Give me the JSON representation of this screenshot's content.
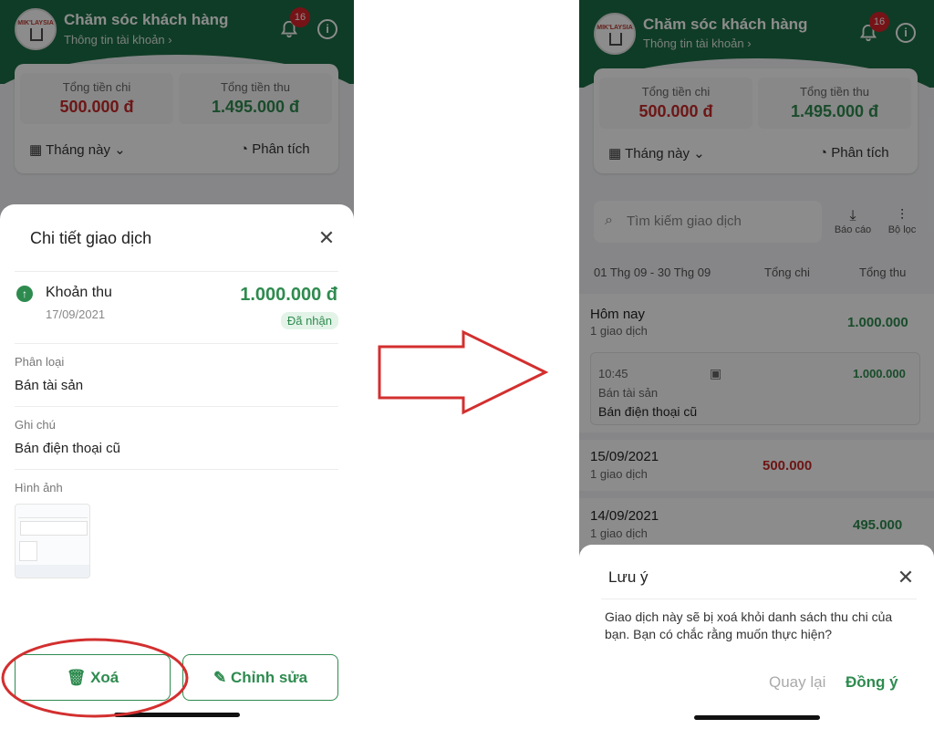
{
  "header": {
    "title": "Chăm sóc khách hàng",
    "subtitle": "Thông tin tài khoản",
    "badge_count": "16",
    "logo_text": "MIK'LAYSIA"
  },
  "summary": {
    "expense_label": "Tổng tiền chi",
    "expense_value": "500.000 đ",
    "income_label": "Tổng tiền thu",
    "income_value": "1.495.000 đ",
    "period_label": "Tháng này",
    "analyze_label": "Phân tích"
  },
  "detail_sheet": {
    "title": "Chi tiết giao dịch",
    "type_label": "Khoản thu",
    "date": "17/09/2021",
    "amount": "1.000.000 đ",
    "status": "Đã nhận",
    "category_label": "Phân loại",
    "category_value": "Bán tài sản",
    "note_label": "Ghi chú",
    "note_value": "Bán điện thoại cũ",
    "image_label": "Hình ảnh",
    "delete_label": "Xoá",
    "edit_label": "Chỉnh sửa"
  },
  "list": {
    "search_placeholder": "Tìm kiếm giao dịch",
    "report_label": "Báo cáo",
    "filter_label": "Bộ lọc",
    "date_range": "01 Thg 09 - 30 Thg 09",
    "col_expense": "Tổng chi",
    "col_income": "Tổng thu",
    "groups": [
      {
        "title": "Hôm nay",
        "count": "1 giao dịch",
        "income": "1.000.000"
      },
      {
        "title": "15/09/2021",
        "count": "1 giao dịch",
        "expense": "500.000"
      },
      {
        "title": "14/09/2021",
        "count": "1 giao dịch",
        "income": "495.000"
      }
    ],
    "item": {
      "time": "10:45",
      "category": "Bán tài sản",
      "note": "Bán điện thoại cũ",
      "income": "1.000.000"
    }
  },
  "confirm_dialog": {
    "title": "Lưu ý",
    "message": "Giao dịch này sẽ bị xoá khỏi danh sách thu chi của bạn. Bạn có chắc rằng muốn thực hiện?",
    "back_label": "Quay lại",
    "confirm_label": "Đồng ý"
  },
  "colors": {
    "brand_green": "#1c6e45",
    "income_green": "#2e8b4f",
    "expense_red": "#c62828",
    "highlight_red": "#d32f2f"
  }
}
